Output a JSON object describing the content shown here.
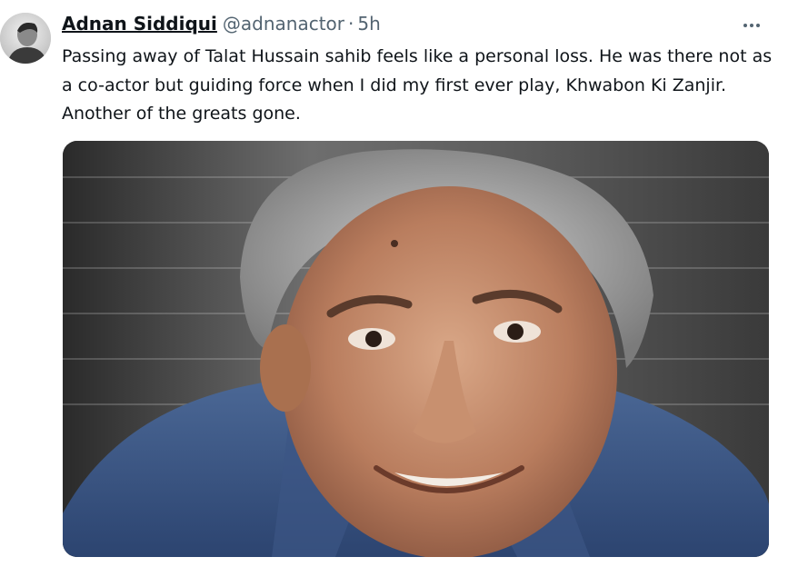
{
  "author": {
    "display_name": "Adnan Siddiqui",
    "handle": "@adnanactor",
    "separator": "·",
    "timestamp": "5h",
    "avatar_icon": "person-avatar"
  },
  "tweet": {
    "text": "Passing away of Talat Hussain sahib feels like a personal loss. He was there not as a co-actor but guiding force when I did my first ever play, Khwabon Ki Zanjir. Another of the greats gone.",
    "more_icon": "ellipsis-icon"
  },
  "media": {
    "type": "photo",
    "subject": "portrait"
  },
  "colors": {
    "text_primary": "#0f1419",
    "text_secondary": "#536471"
  }
}
